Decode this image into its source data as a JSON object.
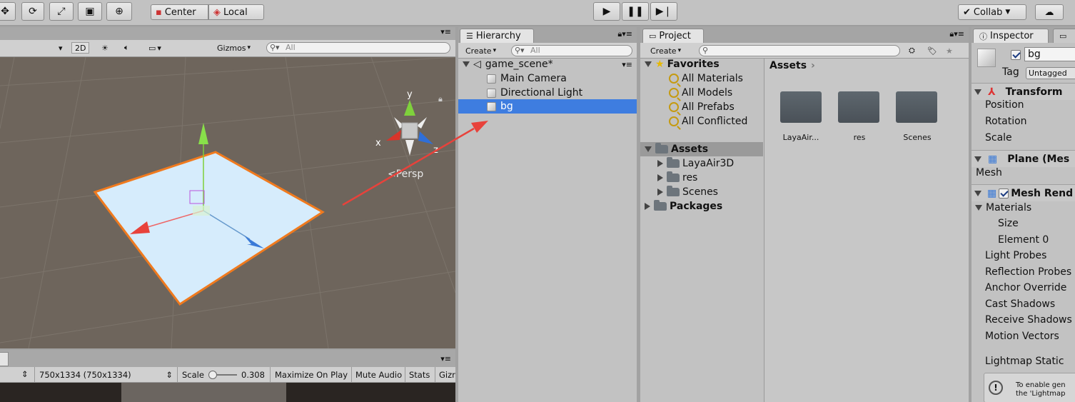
{
  "toolbar": {
    "pivot_center": "Center",
    "pivot_local": "Local",
    "collab": "Collab"
  },
  "scene": {
    "mode_2d": "2D",
    "gizmos": "Gizmos",
    "search_placeholder": "All",
    "persp": "Persp",
    "axis_x": "x",
    "axis_y": "y",
    "axis_z": "z"
  },
  "game": {
    "resolution": "750x1334 (750x1334)",
    "scale_label": "Scale",
    "scale_value": "0.308",
    "maximize": "Maximize On Play",
    "mute": "Mute Audio",
    "stats": "Stats",
    "gizmos_cut": "Gizr"
  },
  "hierarchy": {
    "tab": "Hierarchy",
    "create": "Create",
    "search_placeholder": "All",
    "scene_name": "game_scene*",
    "items": [
      "Main Camera",
      "Directional Light",
      "bg"
    ]
  },
  "project": {
    "tab": "Project",
    "create": "Create",
    "favorites_label": "Favorites",
    "favorites": [
      "All Materials",
      "All Models",
      "All Prefabs",
      "All Conflicted"
    ],
    "assets_label": "Assets",
    "assets_children": [
      "LayaAir3D",
      "res",
      "Scenes"
    ],
    "packages_label": "Packages",
    "breadcrumb": "Assets",
    "grid": [
      "LayaAir...",
      "res",
      "Scenes"
    ]
  },
  "inspector": {
    "tab": "Inspector",
    "name_value": "bg",
    "tag_label": "Tag",
    "tag_value": "Untagged",
    "transform_title": "Transform",
    "transform_rows": [
      "Position",
      "Rotation",
      "Scale"
    ],
    "plane_title": "Plane (Mes",
    "mesh_label": "Mesh",
    "renderer_title": "Mesh Rend",
    "materials_label": "Materials",
    "size_label": "Size",
    "element0_label": "Element 0",
    "renderer_rows": [
      "Light Probes",
      "Reflection Probes",
      "Anchor Override",
      "Cast Shadows",
      "Receive Shadows",
      "Motion Vectors"
    ],
    "lightmap_static": "Lightmap Static",
    "info_line1": "To enable gen",
    "info_line2": "the 'Lightmap"
  },
  "colors": {
    "selection": "#3e7de0",
    "scene_bg": "#6e655c",
    "plane_outline": "#f07a1e",
    "arrow": "#e8423b"
  }
}
